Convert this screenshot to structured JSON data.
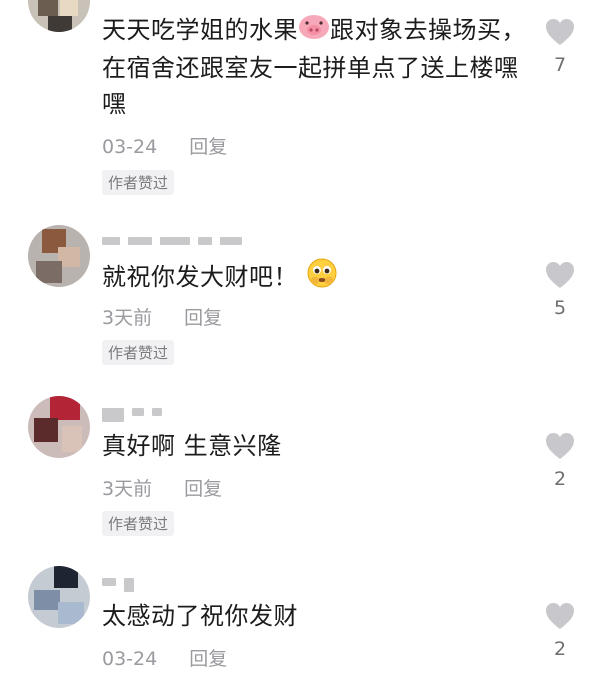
{
  "comments": [
    {
      "text": "天天吃学姐的水果",
      "text_after": "跟对象去操场买，在宿舍还跟室友一起拼单点了送上楼嘿嘿",
      "date": "03-24",
      "reply": "回复",
      "badge": "作者赞过",
      "likes": "7"
    },
    {
      "text": "就祝你发大财吧！",
      "date": "3天前",
      "reply": "回复",
      "badge": "作者赞过",
      "likes": "5"
    },
    {
      "text": "真好啊  生意兴隆",
      "date": "3天前",
      "reply": "回复",
      "badge": "作者赞过",
      "likes": "2"
    },
    {
      "text": "太感动了祝你发财",
      "date": "03-24",
      "reply": "回复",
      "likes": "2"
    }
  ],
  "icons": {
    "like": "heart-icon",
    "emoji_pig": "pig-face-emoji",
    "emoji_pleading": "pleading-face-emoji"
  },
  "colors": {
    "like_heart": "#c7c7cc",
    "meta_text": "#9a9a9f",
    "body_text": "#1c1c1e"
  }
}
